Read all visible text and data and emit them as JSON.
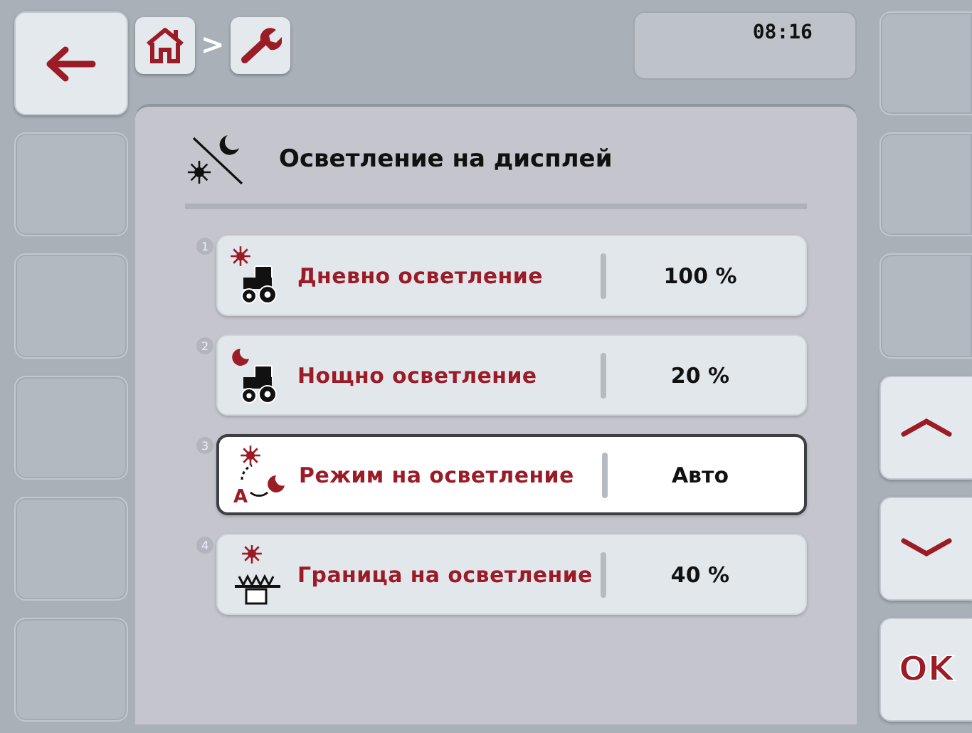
{
  "breadcrumb": [
    {
      "kind": "home"
    },
    {
      "kind": "wrench"
    }
  ],
  "breadcrumb_separator": ">",
  "clock": "08:16",
  "page": {
    "title": "Осветление на дисплей"
  },
  "settings": [
    {
      "number": "1",
      "kind": "day",
      "label": "Дневно осветление",
      "value": "100 %",
      "selected": false
    },
    {
      "number": "2",
      "kind": "night",
      "label": "Нощно осветление",
      "value": "20 %",
      "selected": false
    },
    {
      "number": "3",
      "kind": "auto",
      "icon_letter": "A",
      "label": "Режим на осветление",
      "value": "Авто",
      "selected": true
    },
    {
      "number": "4",
      "kind": "threshold",
      "label": "Граница на осветление",
      "value": "40 %",
      "selected": false
    }
  ],
  "left_softkeys": [
    {
      "kind": "back"
    },
    {
      "kind": "empty"
    },
    {
      "kind": "empty"
    },
    {
      "kind": "empty"
    },
    {
      "kind": "empty"
    },
    {
      "kind": "empty"
    }
  ],
  "right_softkeys": [
    {
      "kind": "empty"
    },
    {
      "kind": "empty"
    },
    {
      "kind": "empty"
    },
    {
      "kind": "up"
    },
    {
      "kind": "down"
    },
    {
      "kind": "ok",
      "label": "OK"
    }
  ]
}
